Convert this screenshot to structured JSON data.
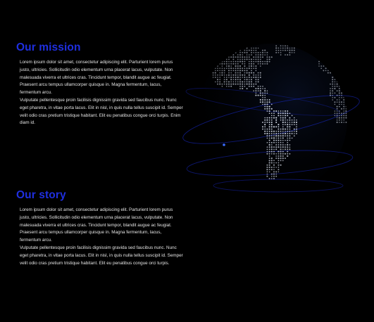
{
  "mission": {
    "heading": "Our mission",
    "paragraph_1": "Lorem ipsum dolor sit amet, consectetur adipiscing elit. Parturient lorem purus justo, ultricies. Sollicitudin odio elementum urna placerat lacus, vulputate. Non malesuada viverra et ultrices cras. Tincidunt tempor, blandit augue ac feugiat. Praesent arcu tempus ullamcorper quisque in. Magna fermentum, lacus, fermentum arcu.",
    "paragraph_2": "Vulputate pellentesque proin facilisis dignissim gravida sed faucibus nunc. Nunc eget pharetra, in vitae porta lacus. Elit in nisl, in quis nulla tellus suscipit id. Semper velit odio cras pretium tristique habitant. Elit eu penatibus congue orci turpis. Enim diam id."
  },
  "story": {
    "heading": "Our story",
    "paragraph_1": "Lorem ipsum dolor sit amet, consectetur adipiscing elit. Parturient lorem purus justo, ultricies. Sollicitudin odio elementum urna placerat lacus, vulputate. Non malesuada viverra et ultrices cras. Tincidunt tempor, blandit augue ac feugiat. Praesent arcu tempus ullamcorper quisque in. Magna fermentum, lacus, fermentum arcu.",
    "paragraph_2": "Vulputate pellentesque proin facilisis dignissim gravida sed faucibus nunc. Nunc eget pharetra, in vitae porta lacus. Elit in nisl, in quis nulla tellus suscipit id. Semper velit odio cras pretium tristique habitant. Elit eu penatibus congue orci turpis."
  },
  "globe": {
    "icon": "globe-illustration",
    "dot_color": "#dfe6f2",
    "ring_color": "#1a2bd6",
    "glow_color": "#3a6cff"
  },
  "colors": {
    "background": "#000000",
    "heading": "#1f2fe0",
    "body_text": "#e6e6e6"
  }
}
